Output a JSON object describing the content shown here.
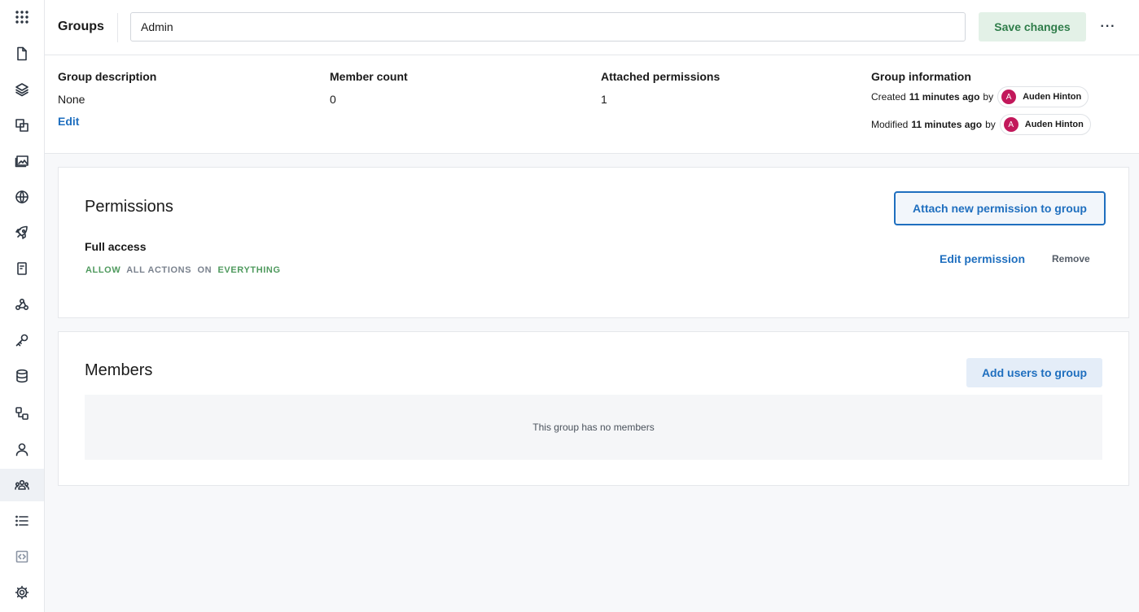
{
  "sidebar": {
    "items": [
      {
        "icon": "apps-grid-icon"
      },
      {
        "icon": "file-icon"
      },
      {
        "icon": "layers-icon"
      },
      {
        "icon": "copy-icon"
      },
      {
        "icon": "images-icon"
      },
      {
        "icon": "globe-icon"
      },
      {
        "icon": "rocket-icon"
      },
      {
        "icon": "notebook-icon"
      },
      {
        "icon": "webhook-icon"
      },
      {
        "icon": "key-icon"
      },
      {
        "icon": "database-icon"
      },
      {
        "icon": "workflow-icon"
      },
      {
        "icon": "user-icon"
      },
      {
        "icon": "users-group-icon"
      },
      {
        "icon": "list-icon"
      },
      {
        "icon": "code-file-icon"
      },
      {
        "icon": "gear-icon"
      }
    ],
    "active": "users-group-icon"
  },
  "header": {
    "title": "Groups",
    "name_value": "Admin",
    "save_label": "Save changes",
    "more_label": "···"
  },
  "info": {
    "description": {
      "label": "Group description",
      "value": "None",
      "edit_label": "Edit"
    },
    "members": {
      "label": "Member count",
      "value": "0"
    },
    "permissions": {
      "label": "Attached permissions",
      "value": "1"
    },
    "group_info": {
      "label": "Group information",
      "created_prefix": "Created",
      "created_when": "11 minutes ago",
      "modified_prefix": "Modified",
      "modified_when": "11 minutes ago",
      "by": "by",
      "user_initial": "A",
      "user_name": "Auden Hinton",
      "avatar_color": "#c2185b"
    }
  },
  "permissions": {
    "title": "Permissions",
    "attach_label": "Attach new permission to group",
    "items": [
      {
        "name": "Full access",
        "effect": "ALLOW",
        "actions": "ALL ACTIONS",
        "on": "ON",
        "target": "EVERYTHING",
        "edit_label": "Edit permission",
        "remove_label": "Remove"
      }
    ]
  },
  "members": {
    "title": "Members",
    "add_label": "Add users to group",
    "empty_text": "This group has no members"
  },
  "colors": {
    "accent": "#1f6fbf",
    "save_bg": "#e3f1e7",
    "save_text": "#2f7d4a",
    "allow_green": "#4f9a5e"
  }
}
